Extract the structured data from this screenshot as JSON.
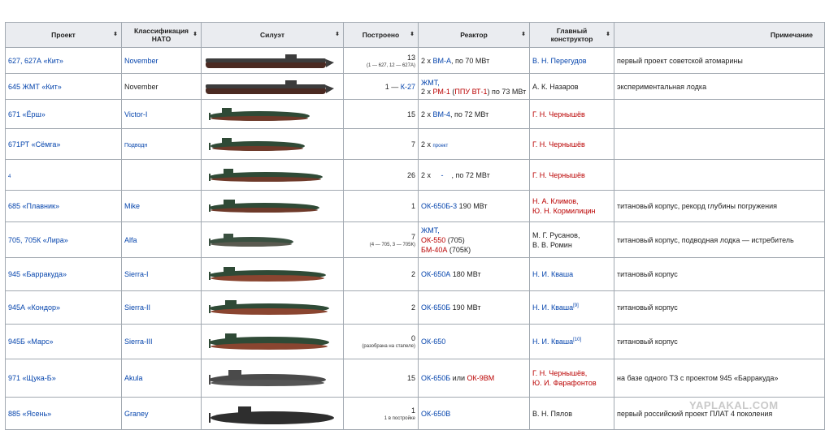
{
  "headers": {
    "project": "Проект",
    "nato": "Классификация НАТО",
    "silhouette": "Силуэт",
    "built": "Построено",
    "reactor": "Реактор",
    "designer": "Главный конструктор",
    "note": "Примечание"
  },
  "sort_icon": "⬍",
  "colors": {
    "link": "#0645ad",
    "redlink": "#ba0000",
    "header_bg": "#eaecf0",
    "hull_dark": "#3c3c3c",
    "hull_green": "#2f4a36",
    "hull_bottom": "#8a4530"
  },
  "rows": [
    {
      "project": "627, 627А «Кит»",
      "nato": "November",
      "built": "13",
      "built_note": "(1 — 627, 12 — 627А)",
      "reactor_pre": "2 х ",
      "reactor_link": "ВМ-А",
      "reactor_post": ", по 70 МВт",
      "designer": "В. Н. Перегудов",
      "note": "первый проект советской атомарины"
    },
    {
      "project": "645 ЖМТ «Кит»",
      "nato": "November",
      "built": "1 — ",
      "built_link": "К-27",
      "reactor_line1": "ЖМТ,",
      "reactor_pre": "2 х ",
      "reactor_red": "РМ-1",
      "reactor_mid": " (",
      "reactor_red2": "ППУ ВТ-1",
      "reactor_post": ") по 73 МВт",
      "designer": "А. К. Назаров",
      "note": "экспериментальная лодка"
    },
    {
      "project": "671 «Ёрш»",
      "nato": "Victor-I",
      "built": "15",
      "reactor_pre": "2 х ",
      "reactor_link": "ВМ-4",
      "reactor_post": ", по 72 МВт",
      "designer": "Г. Н. Чернышёв",
      "note": ""
    },
    {
      "project": "671РТ «Сёмга»",
      "nato": "Подводн",
      "built": "7",
      "reactor_pre": "2 х ",
      "reactor_link": "проект",
      "reactor_post": "",
      "designer": "Г. Н. Чернышёв",
      "note": ""
    },
    {
      "project": "4",
      "nato": "",
      "built": "26",
      "reactor_pre": "2 х ",
      "reactor_link": "-",
      "reactor_post": ", по 72 МВт",
      "designer": "Г. Н. Чернышёв",
      "note": ""
    },
    {
      "project": "685 «Плавник»",
      "nato": "Mike",
      "built": "1",
      "reactor_link": "ОК-650Б-3",
      "reactor_post": " 190 МВт",
      "designer": "Н. А. Климов,",
      "designer2": "Ю. Н. Кормилицин",
      "note": "титановый корпус, рекорд глубины погружения"
    },
    {
      "project": "705, 705К «Лира»",
      "nato": "Alfa",
      "built": "7",
      "built_note": "(4 — 705, 3 — 705К)",
      "reactor_line1": "ЖМТ,",
      "reactor_red": "ОК-550",
      "reactor_mid": " (705)",
      "reactor_red2": "БМ-40А",
      "reactor_post": " (705К)",
      "designer": "М. Г. Русанов,",
      "designer2": "В. В. Ромин",
      "note": "титановый корпус, подводная лодка — истребитель"
    },
    {
      "project": "945 «Барракуда»",
      "nato": "Sierra-I",
      "built": "2",
      "reactor_link": "ОК-650А",
      "reactor_post": " 180 МВт",
      "designer": "Н. И. Кваша",
      "note": "титановый корпус"
    },
    {
      "project": "945А «Кондор»",
      "nato": "Sierra-II",
      "built": "2",
      "reactor_link": "ОК-650Б",
      "reactor_post": " 190 МВт",
      "designer": "Н. И. Кваша",
      "designer_sup": "[9]",
      "note": "титановый корпус"
    },
    {
      "project": "945Б «Марс»",
      "nato": "Sierra-III",
      "built": "0",
      "built_note": "(разобрана на стапеле)",
      "reactor_link": "ОК-650",
      "reactor_post": "",
      "designer": "Н. И. Кваша",
      "designer_sup": "[10]",
      "note": "титановый корпус"
    },
    {
      "project": "971 «Щука-Б»",
      "nato": "Akula",
      "built": "15",
      "reactor_link": "ОК-650Б",
      "reactor_mid": " или ",
      "reactor_red": "ОК-9ВМ",
      "reactor_post": "",
      "designer": "Г. Н. Чернышёв,",
      "designer2": "Ю. И. Фарафонтов",
      "note": "на базе одного ТЗ с проектом 945 «Барракуда»"
    },
    {
      "project": "885 «Ясень»",
      "nato": "Graney",
      "built": "1",
      "built_note": "1 в постройке",
      "reactor_link": "ОК-650В",
      "reactor_post": "",
      "designer": "В. Н. Пялов",
      "note": "первый российский проект ПЛАТ 4 поколения"
    }
  ],
  "watermark": "YAPLAKAL.COM"
}
